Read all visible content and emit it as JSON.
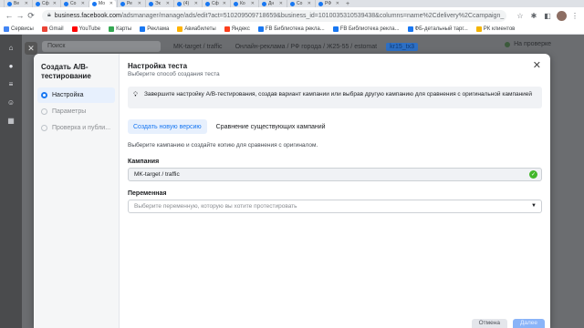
{
  "browser": {
    "tabs": [
      {
        "label": "Ве"
      },
      {
        "label": "Сф"
      },
      {
        "label": "Со"
      },
      {
        "label": "Мо"
      },
      {
        "label": "Ре"
      },
      {
        "label": "Эк"
      },
      {
        "label": "(4)"
      },
      {
        "label": "Сф"
      },
      {
        "label": "Ко"
      },
      {
        "label": "Дн"
      },
      {
        "label": "Со"
      },
      {
        "label": "РФ"
      }
    ],
    "active_tab": 3,
    "url_domain": "business.facebook.com",
    "url_path": "/adsmanager/manage/ads/edit?act=510209509718659&business_id=1010035310539438&columns=name%2Cdelivery%2Ccampaign_",
    "bookmarks": [
      {
        "label": "Сервисы",
        "color": "#4285f4"
      },
      {
        "label": "Gmail",
        "color": "#ea4335"
      },
      {
        "label": "YouTube",
        "color": "#ff0000"
      },
      {
        "label": "Карты",
        "color": "#34a853"
      },
      {
        "label": "Реклама",
        "color": "#1877f2"
      },
      {
        "label": "Авиабилеты",
        "color": "#ffb300"
      },
      {
        "label": "Яндекс",
        "color": "#fc3f1d"
      },
      {
        "label": "FB Библиотека рекла...",
        "color": "#1877f2"
      },
      {
        "label": "FB Библиотека рекла...",
        "color": "#1877f2"
      },
      {
        "label": "ФБ-детальный тарг...",
        "color": "#1877f2"
      },
      {
        "label": "РК клиентов",
        "color": "#f4b400"
      }
    ]
  },
  "background": {
    "search_placeholder": "Поиск",
    "breadcrumbs": [
      "MK-target / traffic",
      "Онлайн-реклама / РФ города / Ж25-55 / estomat",
      "kr15_tx3"
    ],
    "review_label": "На проверке"
  },
  "wizard": {
    "title": "Создать A/B-тестирование",
    "steps": [
      {
        "label": "Настройка"
      },
      {
        "label": "Параметры"
      },
      {
        "label": "Проверка и публи..."
      }
    ],
    "active_step": 0
  },
  "content": {
    "title": "Настройка теста",
    "subtitle": "Выберите способ создания теста",
    "banner_text": "Завершите настройку A/B-тестирования, создав вариант кампании или выбрав другую кампанию для сравнения с оригинальной кампанией",
    "tabs": [
      {
        "label": "Создать новую версию"
      },
      {
        "label": "Сравнение существующих кампаний"
      }
    ],
    "active_tab": 0,
    "intro": "Выберите кампанию и создайте копию для сравнения с оригиналом.",
    "campaign_label": "Кампания",
    "campaign_value": "MK-target / traffic",
    "variable_label": "Переменная",
    "variable_placeholder": "Выберите переменную, которую вы хотите протестировать"
  },
  "footer": {
    "cancel_label": "Отмена",
    "next_label": "Далее"
  },
  "colors": {
    "accent": "#1877f2",
    "success": "#42b72a"
  }
}
